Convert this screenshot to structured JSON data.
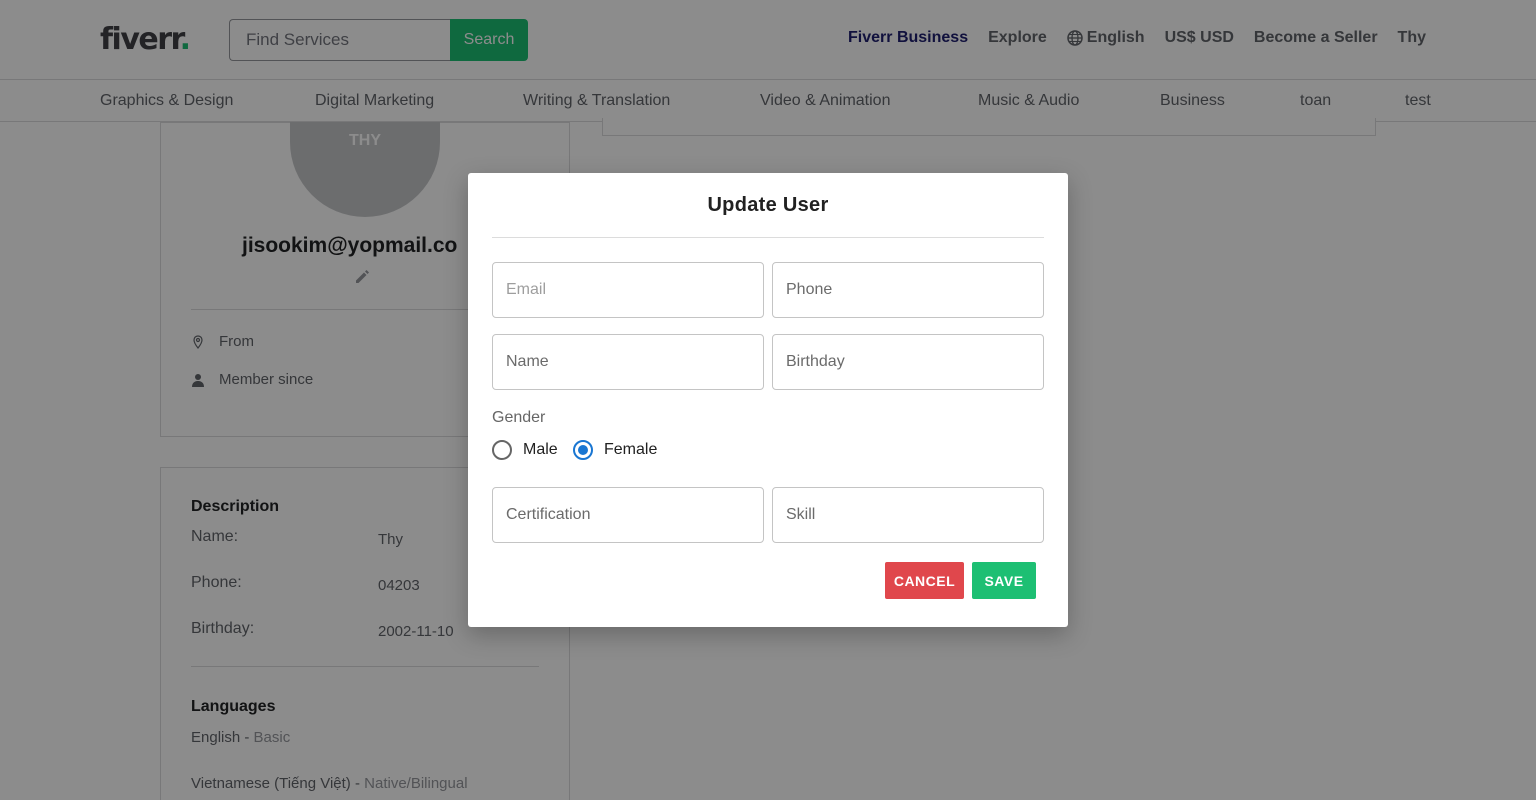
{
  "header": {
    "logo_text": "fiverr",
    "logo_dot": ".",
    "search_placeholder": "Find Services",
    "search_button": "Search",
    "nav": {
      "business": "Fiverr Business",
      "explore": "Explore",
      "language": "English",
      "currency": "US$ USD",
      "become_seller": "Become a Seller",
      "user": "Thy"
    }
  },
  "categories": [
    "Graphics & Design",
    "Digital Marketing",
    "Writing & Translation",
    "Video & Animation",
    "Music & Audio",
    "Business",
    "toan",
    "test"
  ],
  "profile": {
    "avatar_initials": "THY",
    "email": "jisookim@yopmail.co",
    "from_label": "From",
    "member_since_label": "Member since"
  },
  "description": {
    "title": "Description",
    "rows": [
      {
        "label": "Name:",
        "value": "Thy"
      },
      {
        "label": "Phone:",
        "value": "04203"
      },
      {
        "label": "Birthday:",
        "value": "2002-11-10"
      }
    ]
  },
  "languages": {
    "title": "Languages",
    "items": [
      {
        "name": "English",
        "sep": " - ",
        "level": "Basic"
      },
      {
        "name": "Vietnamese (Tiếng Việt)",
        "sep": " - ",
        "level": "Native/Bilingual"
      }
    ]
  },
  "modal": {
    "title": "Update User",
    "email_placeholder": "Email",
    "phone_placeholder": "Phone",
    "name_placeholder": "Name",
    "birthday_placeholder": "Birthday",
    "gender_label": "Gender",
    "gender_male": "Male",
    "gender_female": "Female",
    "gender_selected": "Female",
    "certification_placeholder": "Certification",
    "skill_placeholder": "Skill",
    "cancel_label": "CANCEL",
    "save_label": "SAVE"
  },
  "colors": {
    "brand_green": "#1dbf73",
    "cancel_red": "#e0474c",
    "radio_blue": "#1976d2",
    "business_navy": "#1f1f70"
  }
}
